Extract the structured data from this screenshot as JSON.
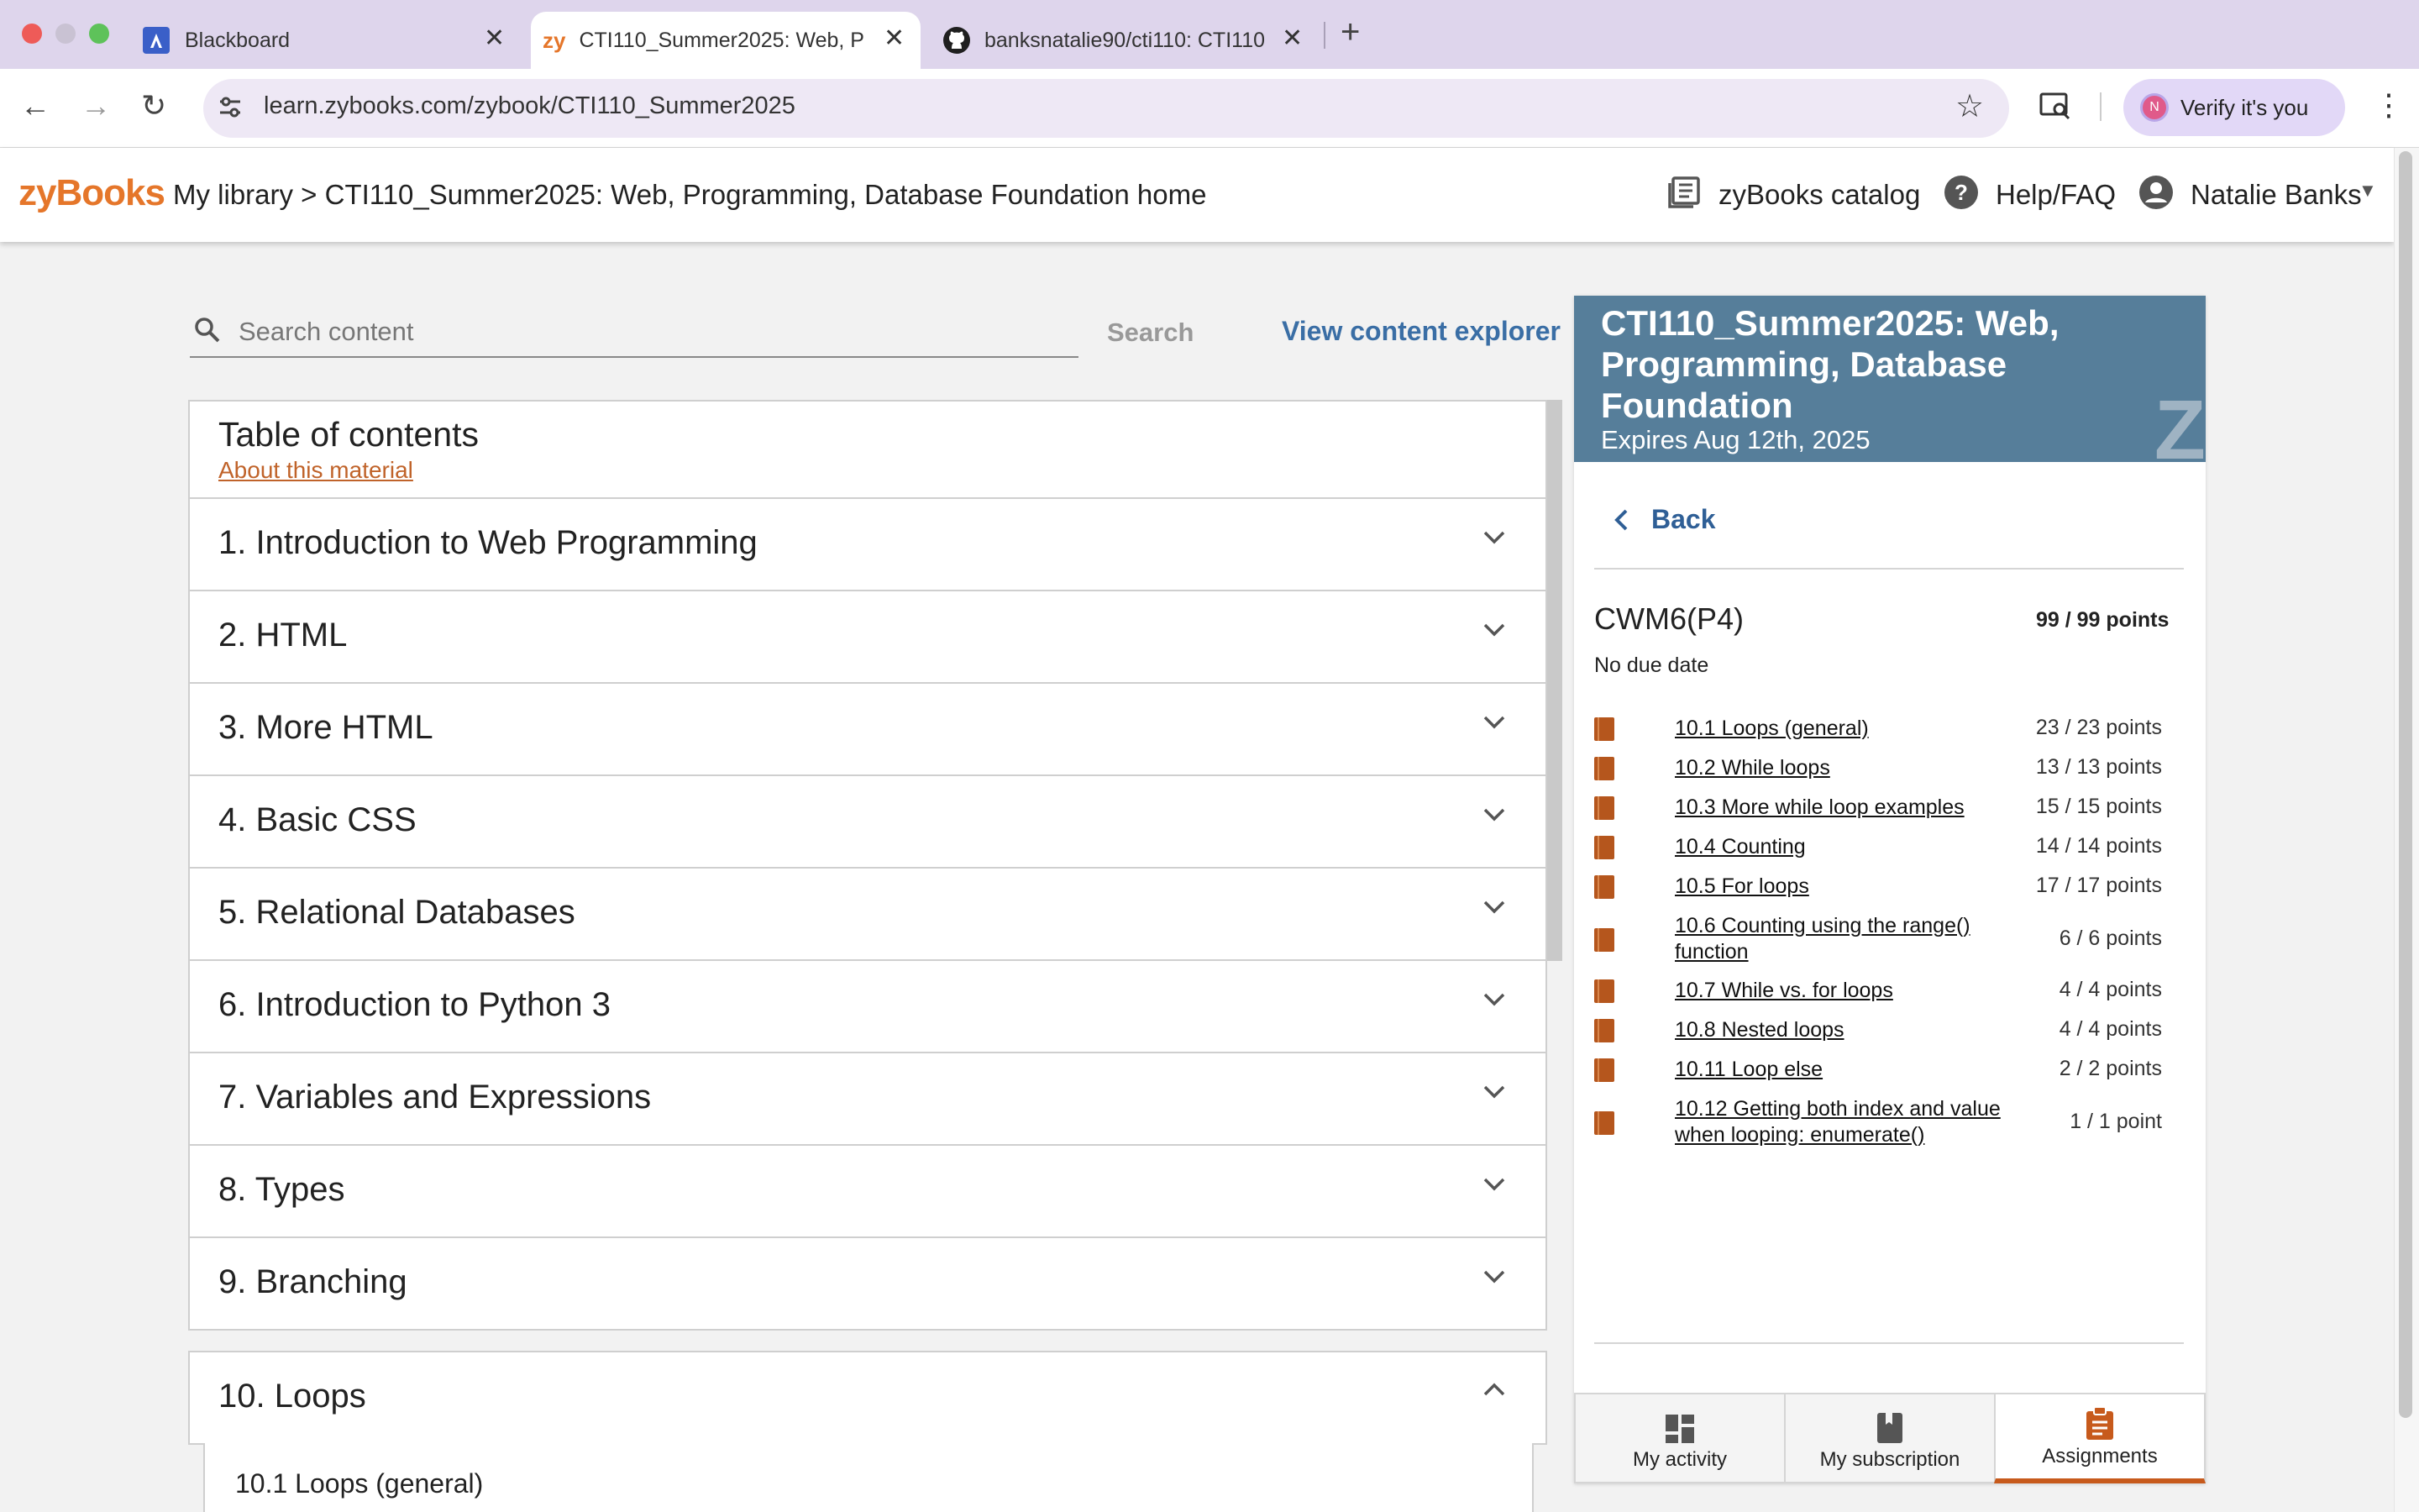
{
  "browser": {
    "tabs": [
      {
        "label": "Blackboard"
      },
      {
        "label": "CTI110_Summer2025: Web, P"
      },
      {
        "label": "banksnatalie90/cti110: CTI110"
      }
    ],
    "tab_zy_glyph": "zy",
    "url": "learn.zybooks.com/zybook/CTI110_Summer2025",
    "verify_label": "Verify it's you",
    "verify_avatar": "N"
  },
  "header": {
    "logo": "zyBooks",
    "breadcrumb": "My library > CTI110_Summer2025: Web, Programming, Database Foundation home",
    "catalog": "zyBooks catalog",
    "help": "Help/FAQ",
    "user": "Natalie Banks"
  },
  "search": {
    "placeholder": "Search content",
    "button": "Search",
    "explorer": "View content explorer"
  },
  "toc": {
    "title": "Table of contents",
    "about": "About this material",
    "chapters": [
      "1. Introduction to Web Programming",
      "2. HTML",
      "3. More HTML",
      "4. Basic CSS",
      "5. Relational Databases",
      "6. Introduction to Python 3",
      "7. Variables and Expressions",
      "8. Types",
      "9. Branching"
    ],
    "expanded_chapter": "10. Loops",
    "expanded_first_section": "10.1 Loops (general)"
  },
  "panel": {
    "course_title": "CTI110_Summer2025: Web, Programming, Database Foundation",
    "expires": "Expires Aug 12th, 2025",
    "back": "Back",
    "assignment": {
      "name": "CWM6(P4)",
      "points": "99 / 99 points",
      "due": "No due date",
      "items": [
        {
          "label": "10.1 Loops (general)",
          "points": "23 / 23 points"
        },
        {
          "label": "10.2 While loops",
          "points": "13 / 13 points"
        },
        {
          "label": "10.3 More while loop examples",
          "points": "15 / 15 points"
        },
        {
          "label": "10.4 Counting",
          "points": "14 / 14 points"
        },
        {
          "label": "10.5 For loops",
          "points": "17 / 17 points"
        },
        {
          "label": "10.6 Counting using the range() function",
          "points": "6 / 6 points"
        },
        {
          "label": "10.7 While vs. for loops",
          "points": "4 / 4 points"
        },
        {
          "label": "10.8 Nested loops",
          "points": "4 / 4 points"
        },
        {
          "label": "10.11 Loop else",
          "points": "2 / 2 points"
        },
        {
          "label": "10.12 Getting both index and value when looping: enumerate()",
          "points": "1 / 1 point"
        }
      ]
    },
    "bottom_tabs": {
      "activity": "My activity",
      "subscription": "My subscription",
      "assignments": "Assignments"
    }
  },
  "colors": {
    "brand_orange": "#e5762a",
    "panel_header": "#567e9a",
    "link_blue": "#3a6ea5",
    "book_icon": "#b5561d",
    "active_tab_underline": "#c75a1c"
  }
}
